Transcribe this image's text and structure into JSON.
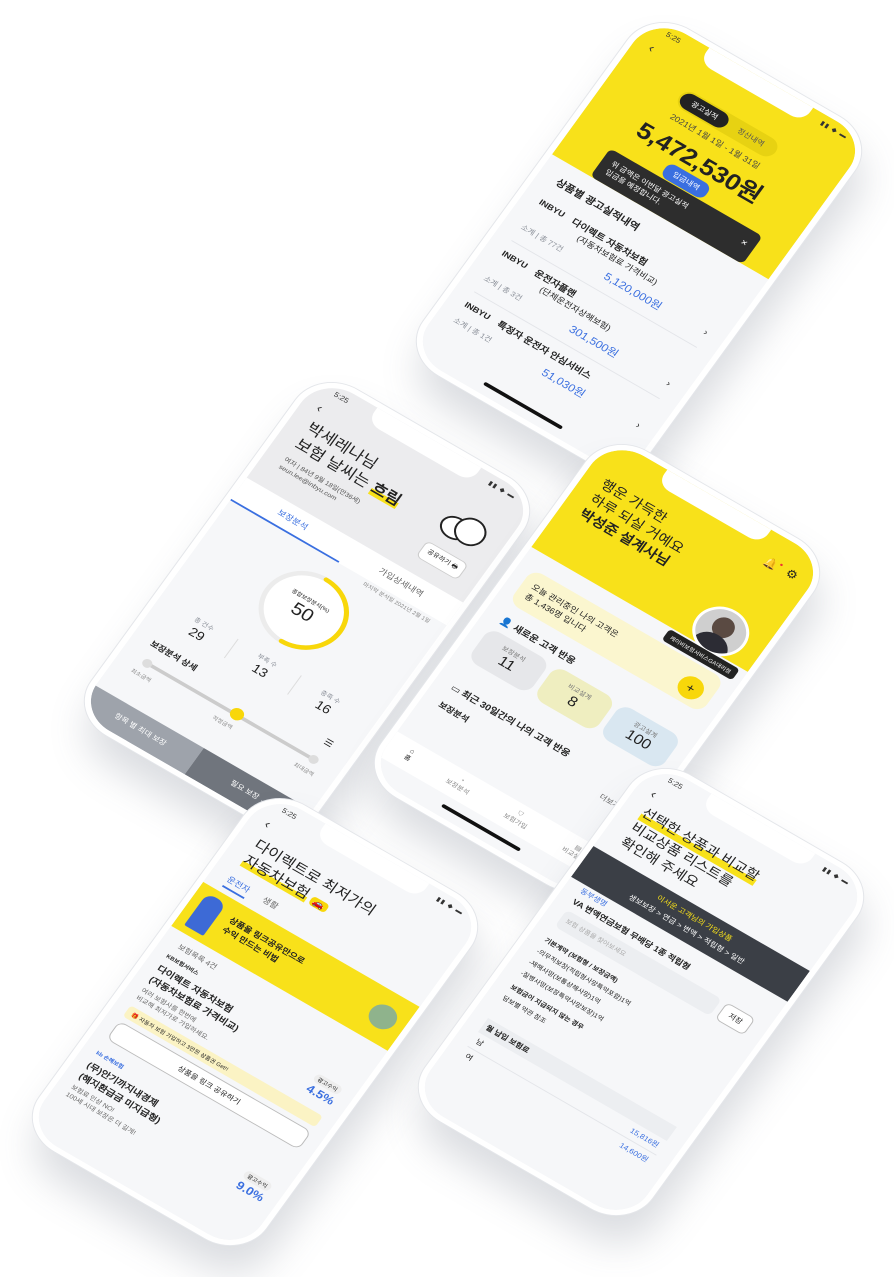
{
  "p1": {
    "time": "5:25",
    "status_icons": "▮▮ ◆ ▬",
    "tab_active": "광고실적",
    "tab_other": "정산내역",
    "period": "2021년 1월 1일 - 1월 31일",
    "amount": "5,472,530원",
    "cta": "입금내역",
    "tooltip_line1": "위 금액은 이번달 광고실적",
    "tooltip_line2": "입금을 예정합니다.",
    "tooltip_close": "✕",
    "section_title": "상품별 광고실적내역",
    "items": [
      {
        "logo": "INBYU",
        "name1": "다이렉트 자동차보험",
        "name2": "(자동차보험료 가격비교)",
        "meta_label": "소계",
        "meta_value": "총 77건",
        "amount": "5,120,000원"
      },
      {
        "logo": "INBYU",
        "name1": "운전자플랜",
        "name2": "(단체운전자상해보험)",
        "meta_label": "소계",
        "meta_value": "총 3건",
        "amount": "301,500원"
      },
      {
        "logo": "INBYU",
        "name1": "특정자 운전자 안심서비스",
        "name2": "",
        "meta_label": "소계",
        "meta_value": "총 1건",
        "amount": "51,030원"
      }
    ]
  },
  "p2": {
    "time": "5:25",
    "status_icons": "▮▮ ◆ ▬",
    "title_line1": "박세레나님",
    "title_line2_a": "보험 날씨는 ",
    "title_line2_b": "흐림",
    "info1": "여자  |  84년 9월 18일(만36세)",
    "info2": "seun.lee@inbyu.com",
    "share_label": "공유하기",
    "tab_active": "보장분석",
    "tab_other": "가입상세내역",
    "updated": "마지막 분석일 2021년 2월 1일",
    "score_label": "종합보장분석(%)",
    "score": "50",
    "score_value": 0.5,
    "stats": [
      {
        "label": "총 건수",
        "value": "29"
      },
      {
        "label": "부족 수",
        "value": "13"
      },
      {
        "label": "충족 수",
        "value": "16"
      }
    ],
    "detail_title": "보장분석 상세",
    "slider": [
      "최소금액",
      "적정금액",
      "최대금액"
    ],
    "footer_left": "항목 별 최대 보장",
    "footer_right": "필요 보장"
  },
  "p3": {
    "greeting1": "행운 가득한",
    "greeting2": "하루 되실 거예요",
    "name": "박성준 설계사님",
    "company": "케이비보험서비스GA대리점",
    "bell_dot": "●",
    "notice_line1": "오늘 관리중인 나의 고객은",
    "notice_line2": "총 1,436명 입니다",
    "new_title": "새로운 고객 반응",
    "reactions": [
      {
        "label": "보장분석",
        "value": "11",
        "color": "#e6e7ea"
      },
      {
        "label": "비교설계",
        "value": "8",
        "color": "#efeec0"
      },
      {
        "label": "광고설계",
        "value": "100",
        "color": "#d9e7f1"
      }
    ],
    "plus": "+",
    "recent_title": "최근 30일간의 나의 고객 반응",
    "analysis": "보장분석",
    "more": "더보기 >",
    "nav": [
      "홈",
      "보장분석",
      "보험가입",
      "비교설계"
    ]
  },
  "p4": {
    "time": "5:25",
    "status_icons": "▮▮ ◆ ▬",
    "title_line1": "다이렉트로 최저가의",
    "title_line2": "자동차보험",
    "tab_active": "운전자",
    "tab_other": "생활",
    "banner_line1": "상품을 링크공유만으로",
    "banner_line2": "수익 만드는 비법",
    "product_count": "보험목록 4건",
    "products": [
      {
        "logo": "KB보험서비스",
        "name1": "다이렉트 자동차보험",
        "name2": "(자동차보험료 가격비교)",
        "desc1": "여러 보험사를 한번에",
        "desc2": "비교해 최저가로 가입하세요.",
        "rate_label": "광고수익",
        "rate": "4.5%",
        "promo": "자동차 보험 가입하고 3만원 상품권 Get!!",
        "share": "상품을 링크 공유하기"
      },
      {
        "logo": "kb 손해보험",
        "name1": "(무)안기까지내경제",
        "name2": "(해지환급금 미지급형)",
        "desc1": "보험료 인상 NO!",
        "desc2": "100세 시대 보장은 더 길게!",
        "rate_label": "광고수익",
        "rate": "9.0%",
        "promo": "",
        "share": ""
      }
    ]
  },
  "p5": {
    "time": "5:25",
    "status_icons": "▮▮ ◆ ▬",
    "title_line1": "선택한 상품과 비교할",
    "title_line2": "비교상품 리스트를",
    "title_line3": "확인해 주세요",
    "steps_top": "이서운 고객님의 가입상품",
    "steps": "생보보장 > 연금 > 변액 > 적립형 > 일반",
    "product_label": "동부생명",
    "product_name": "VA 변액연금보험 무배당 1종 적립형",
    "search_placeholder": "보험 상품을 찾아보세요",
    "save": "저장",
    "items": [
      "기본계약 (보험형 / 보장금액)",
      "-의무적보장(적립형사망특약포함)1억",
      "-재해사망(보통상해사망)1억",
      "-질병사망(보장특약사망보장)1억",
      "보험금이 지급되지 않는 경우",
      "담보별 약관 참조"
    ],
    "table_title": "월 납입 보험료",
    "rows": [
      {
        "label": "남",
        "value": "15,816원"
      },
      {
        "label": "여",
        "value": "14,600원"
      }
    ]
  }
}
